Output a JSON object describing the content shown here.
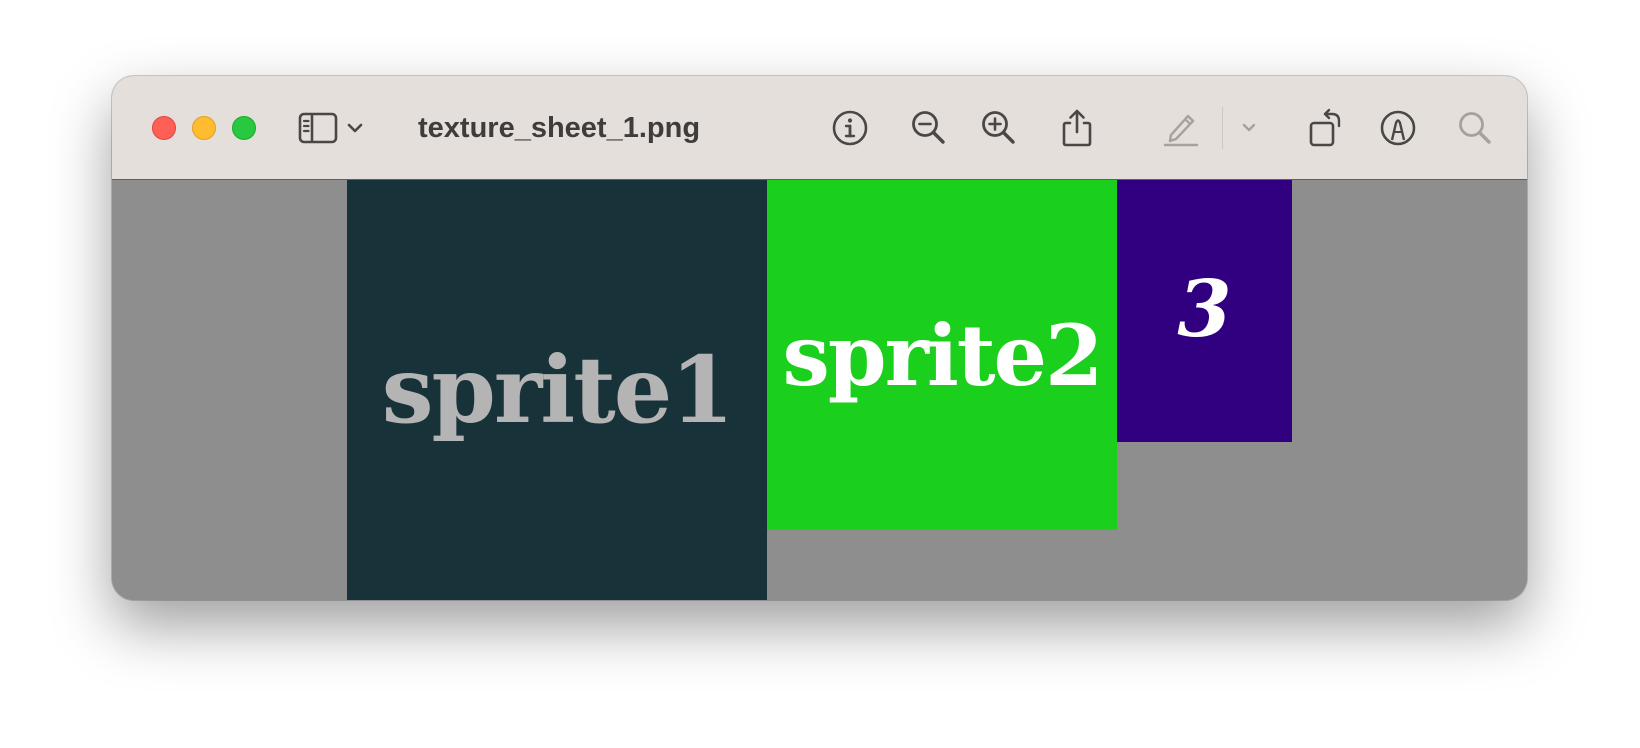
{
  "window": {
    "title": "texture_sheet_1.png",
    "toolbar": {
      "sidebar_icon": "sidebar-icon",
      "sidebar_menu_icon": "chevron-down-icon",
      "info_icon": "info-icon",
      "zoom_out_icon": "zoom-out-icon",
      "zoom_in_icon": "zoom-in-icon",
      "share_icon": "share-icon",
      "highlight_icon": "highlighter-icon",
      "highlight_menu_icon": "chevron-down-icon",
      "rotate_icon": "rotate-left-icon",
      "markup_icon": "markup-icon",
      "search_icon": "search-icon"
    }
  },
  "image": {
    "sprites": [
      {
        "label": "sprite1",
        "color": "#18323a",
        "text_color": "#b4b4b4"
      },
      {
        "label": "sprite2",
        "color": "#1bcf1d",
        "text_color": "#ffffff"
      },
      {
        "label": "3",
        "color": "#300080",
        "text_color": "#ffffff"
      }
    ],
    "background_color": "#8e8e8e"
  },
  "colors": {
    "titlebar": "#e4dfdb",
    "close": "#fe5f57",
    "minimize": "#febc2e",
    "zoom": "#28c840"
  }
}
